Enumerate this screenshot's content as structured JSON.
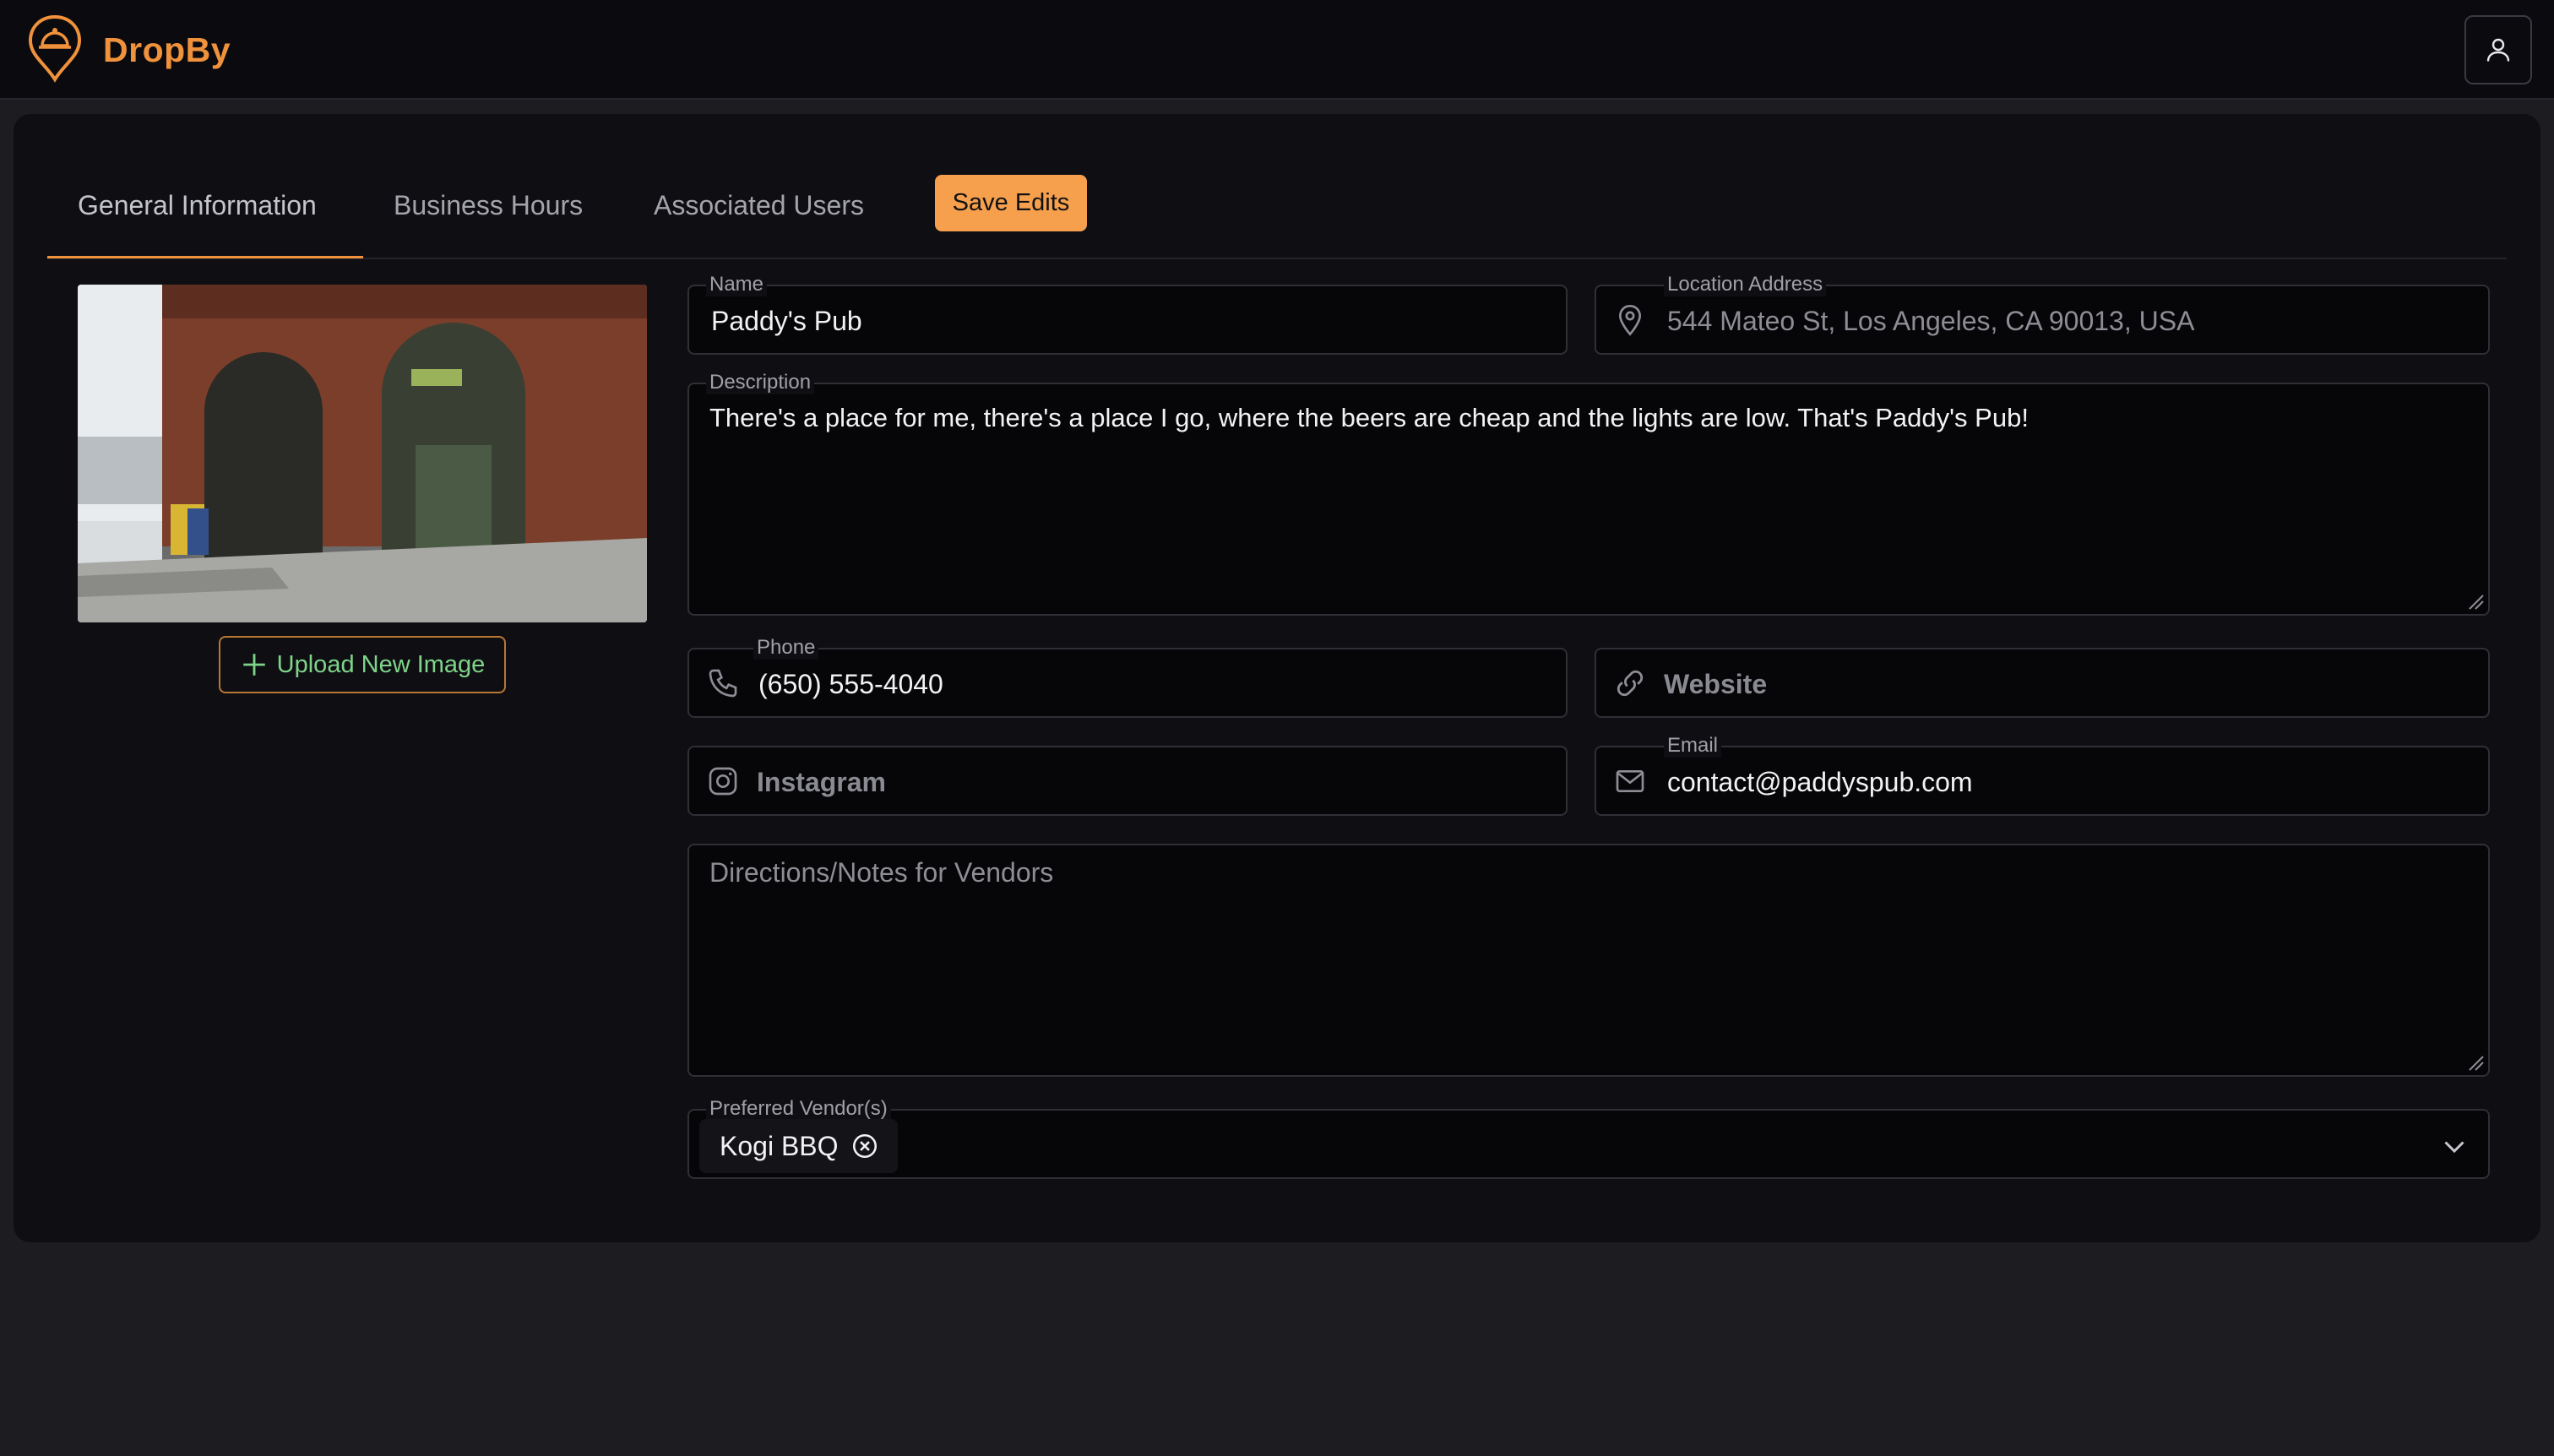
{
  "app": {
    "brand": "DropBy",
    "accent": "#f0923c"
  },
  "tabs": [
    {
      "label": "General Information"
    },
    {
      "label": "Business Hours"
    },
    {
      "label": "Associated Users"
    }
  ],
  "save_button": "Save Edits",
  "upload_button": "Upload New Image",
  "fields": {
    "name": {
      "label": "Name",
      "value": "Paddy's Pub"
    },
    "location": {
      "label": "Location Address",
      "value": "544 Mateo St, Los Angeles, CA 90013, USA"
    },
    "description": {
      "label": "Description",
      "value": "There's a place for me, there's a place I go, where the beers are cheap and the lights are low. That's Paddy's Pub!"
    },
    "phone": {
      "label": "Phone",
      "value": "(650) 555-4040"
    },
    "website": {
      "placeholder": "Website"
    },
    "instagram": {
      "placeholder": "Instagram"
    },
    "email": {
      "label": "Email",
      "value": "contact@paddyspub.com"
    },
    "notes": {
      "placeholder": "Directions/Notes for Vendors"
    },
    "vendors": {
      "label": "Preferred Vendor(s)",
      "chips": [
        "Kogi BBQ"
      ]
    }
  },
  "icons": [
    "logo-pin-icon",
    "user-icon",
    "plus-icon",
    "map-pin-icon",
    "phone-icon",
    "link-icon",
    "instagram-icon",
    "mail-icon",
    "remove-chip-icon",
    "chevron-down-icon"
  ]
}
